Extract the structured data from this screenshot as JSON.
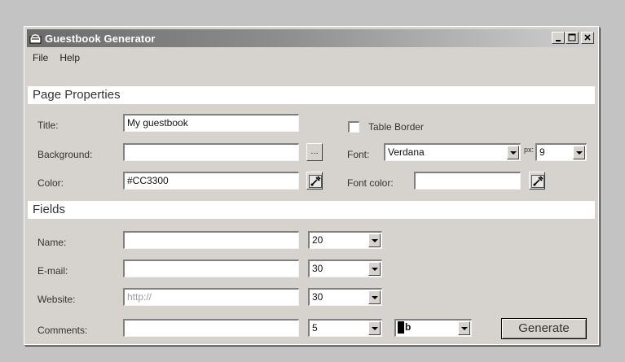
{
  "window": {
    "title": "Guestbook Generator"
  },
  "menu": {
    "file": "File",
    "help": "Help"
  },
  "page_properties": {
    "heading": "Page Properties",
    "title_label": "Title:",
    "title_value": "My guestbook",
    "background_label": "Background:",
    "background_value": "",
    "browse_label": "...",
    "color_label": "Color:",
    "color_value": "#CC3300",
    "table_border_label": "Table Border",
    "table_border_checked": false,
    "font_label": "Font:",
    "font_value": "Verdana",
    "px_label": "px:",
    "px_value": "9",
    "font_color_label": "Font color:",
    "font_color_value": ""
  },
  "fields": {
    "heading": "Fields",
    "rows": [
      {
        "label": "Name:",
        "value": "",
        "placeholder": "",
        "size": "20"
      },
      {
        "label": "E-mail:",
        "value": "",
        "placeholder": "",
        "size": "30"
      },
      {
        "label": "Website:",
        "value": "",
        "placeholder": "http://",
        "size": "30"
      },
      {
        "label": "Comments:",
        "value": "",
        "placeholder": "",
        "size": "5"
      }
    ],
    "style_value": "b"
  },
  "actions": {
    "generate": "Generate"
  }
}
